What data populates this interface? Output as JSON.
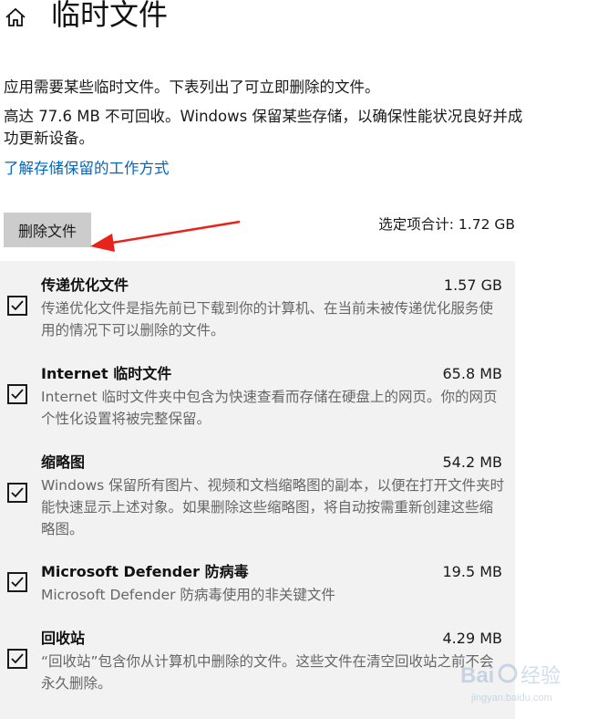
{
  "header": {
    "title": "临时文件",
    "home_icon": "home-icon"
  },
  "intro": {
    "line1": "应用需要某些临时文件。下表列出了可立即删除的文件。",
    "line2": "高达 77.6 MB 不可回收。Windows 保留某些存储，以确保性能状况良好并成功更新设备。",
    "learn_link": "了解存储保留的工作方式"
  },
  "actions": {
    "delete_label": "删除文件",
    "total_label": "选定项合计: 1.72 GB"
  },
  "items": [
    {
      "name": "传递优化文件",
      "size": "1.57 GB",
      "desc": "传递优化文件是指先前已下载到你的计算机、在当前未被传递优化服务使用的情况下可以删除的文件。",
      "checked": true
    },
    {
      "name": "Internet 临时文件",
      "size": "65.8 MB",
      "desc": "Internet 临时文件夹中包含为快速查看而存储在硬盘上的网页。你的网页个性化设置将被完整保留。",
      "checked": true
    },
    {
      "name": "缩略图",
      "size": "54.2 MB",
      "desc": "Windows 保留所有图片、视频和文档缩略图的副本，以便在打开文件夹时能快速显示上述对象。如果删除这些缩略图，将自动按需重新创建这些缩略图。",
      "checked": true
    },
    {
      "name": "Microsoft Defender 防病毒",
      "size": "19.5 MB",
      "desc": "Microsoft Defender 防病毒使用的非关键文件",
      "checked": true
    },
    {
      "name": "回收站",
      "size": "4.29 MB",
      "desc": "“回收站”包含你从计算机中删除的文件。这些文件在清空回收站之前不会永久删除。",
      "checked": true
    }
  ],
  "annotation": {
    "arrow_color": "#e8231b",
    "icon": "red-arrow-icon"
  },
  "watermark": {
    "text_main": "Bai 经验",
    "text_sub": "jingyan.baidu.com"
  },
  "colors": {
    "link": "#0067c0",
    "panel_bg": "#f2f2f2",
    "button_bg": "#cccccc"
  }
}
